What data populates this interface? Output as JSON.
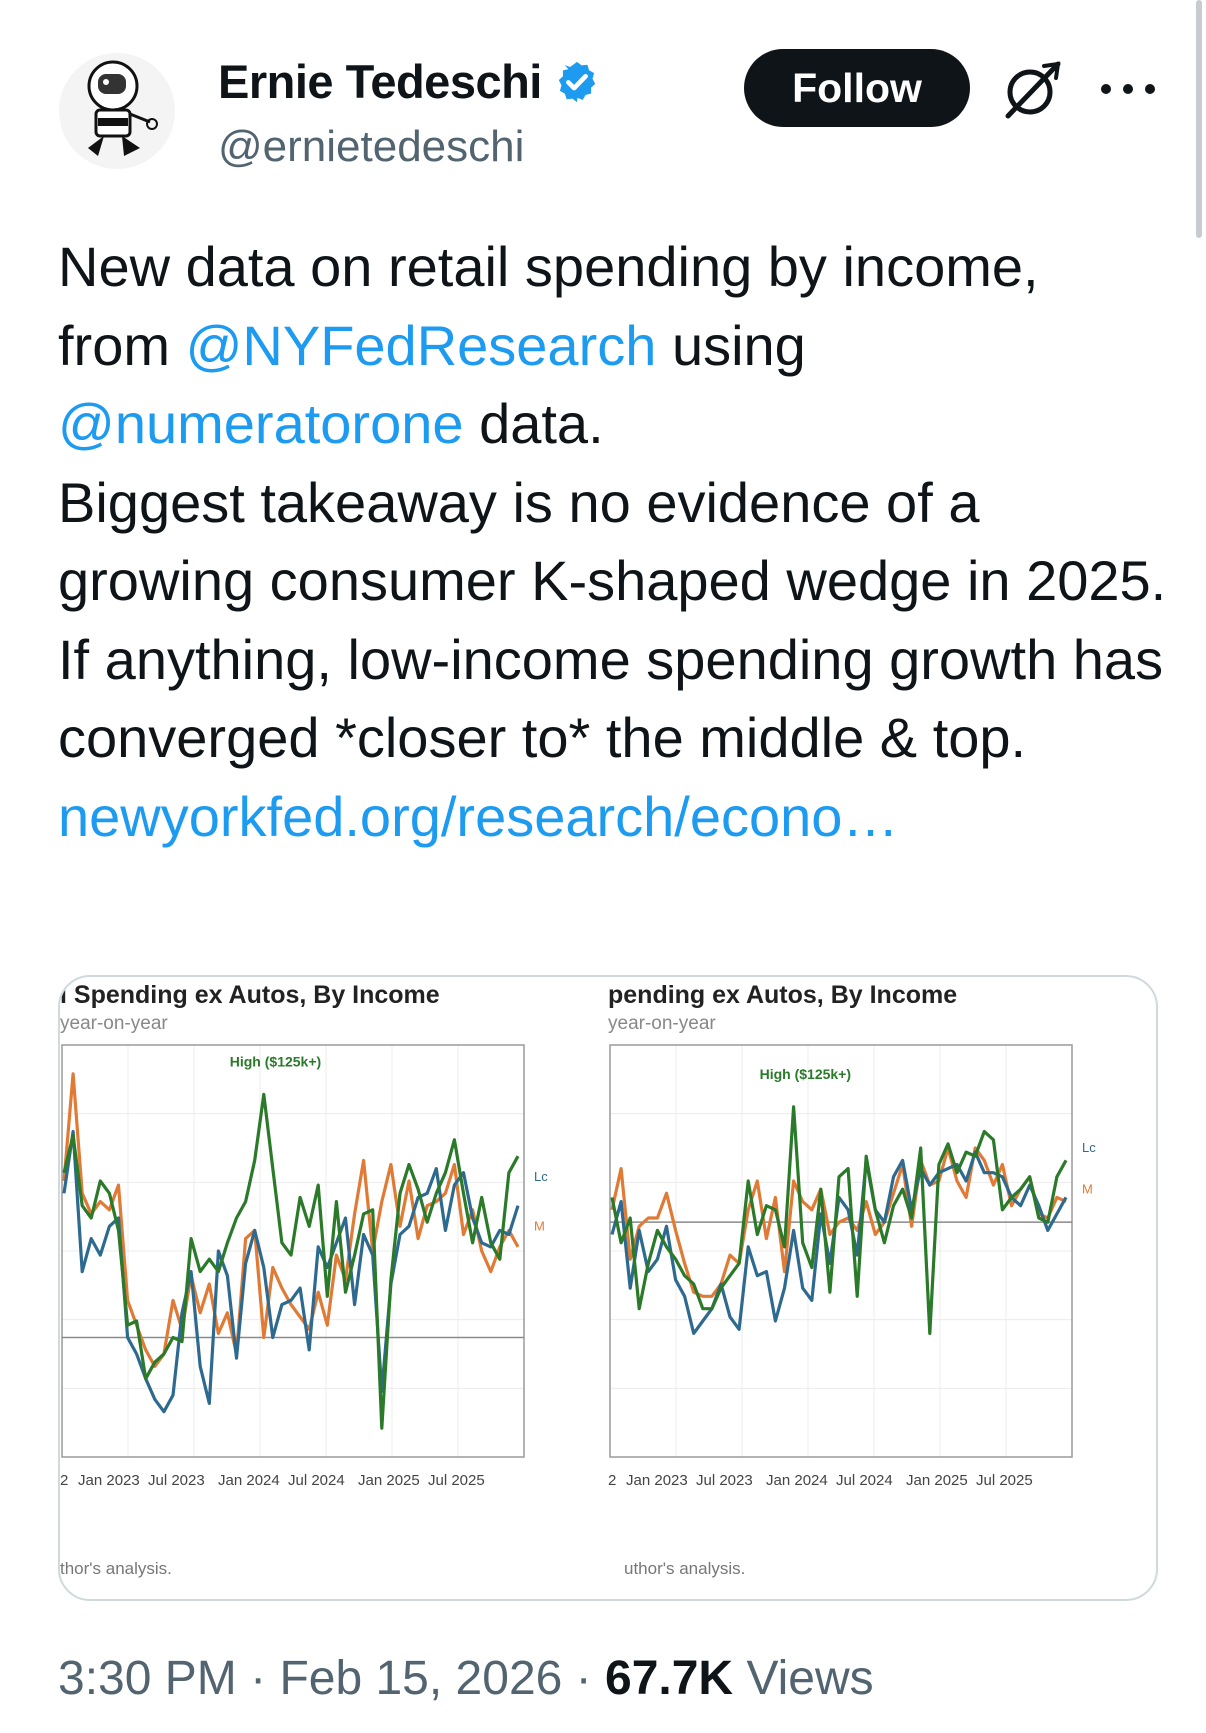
{
  "author": {
    "name": "Ernie Tedeschi",
    "handle": "@ernietedeschi",
    "verified": true,
    "verified_color": "#1d9bf0"
  },
  "actions": {
    "follow_label": "Follow",
    "grok_icon": "grok-icon",
    "more_icon": "more-icon"
  },
  "tweet": {
    "line1": "New data on retail spending by income,",
    "from_word": "from",
    "mention_nyfed": "@NYFedResearch",
    "using_word": "using",
    "mention_numerator": "@numeratorone",
    "data_word": "data.",
    "paragraph2": "Biggest takeaway is no evidence of a growing consumer K-shaped wedge in 2025. If anything, low-income spending growth has converged *closer to* the middle & top.",
    "link": "newyorkfed.org/research/econo…",
    "link_color": "#1d9bf0"
  },
  "media": {
    "left_title": "l Spending ex Autos, By Income",
    "left_subtitle": "year-on-year",
    "left_source": "thor's analysis.",
    "right_title": "pending ex Autos, By Income",
    "right_subtitle": "year-on-year",
    "right_source": "uthor's analysis."
  },
  "chart_data": [
    {
      "type": "line",
      "title": "l Spending ex Autos, By Income",
      "subtitle": "year-on-year",
      "x_tick_labels": [
        "2",
        "Jan 2023",
        "Jul 2023",
        "Jan 2024",
        "Jul 2024",
        "Jan 2025",
        "Jul 2025"
      ],
      "grid": true,
      "has_reference_line": true,
      "annotations": [
        "High ($125k+)",
        "Lc",
        "M"
      ],
      "x": [
        0,
        1,
        2,
        3,
        4,
        5,
        6,
        7,
        8,
        9,
        10,
        11,
        12,
        13,
        14,
        15,
        16,
        17,
        18,
        19,
        20,
        21,
        22,
        23,
        24,
        25,
        26,
        27,
        28,
        29,
        30,
        31,
        32,
        33,
        34,
        35,
        36,
        37,
        38,
        39,
        40,
        41,
        42,
        43,
        44,
        45,
        46,
        47,
        48,
        49,
        50
      ],
      "series": [
        {
          "name": "High ($125k+)",
          "color": "#2a7a2a",
          "values": [
            0.69,
            0.78,
            0.61,
            0.58,
            0.67,
            0.64,
            0.55,
            0.32,
            0.33,
            0.19,
            0.23,
            0.25,
            0.29,
            0.28,
            0.53,
            0.45,
            0.48,
            0.45,
            0.52,
            0.58,
            0.62,
            0.72,
            0.88,
            0.7,
            0.52,
            0.49,
            0.63,
            0.56,
            0.66,
            0.39,
            0.62,
            0.4,
            0.49,
            0.59,
            0.6,
            0.07,
            0.43,
            0.64,
            0.71,
            0.65,
            0.57,
            0.64,
            0.69,
            0.77,
            0.64,
            0.52,
            0.63,
            0.52,
            0.48,
            0.69,
            0.73
          ]
        },
        {
          "name": "",
          "color": "#e07a35",
          "values": [
            0.67,
            0.93,
            0.64,
            0.59,
            0.62,
            0.6,
            0.66,
            0.38,
            0.32,
            0.26,
            0.22,
            0.25,
            0.38,
            0.31,
            0.44,
            0.35,
            0.42,
            0.3,
            0.35,
            0.25,
            0.53,
            0.55,
            0.29,
            0.46,
            0.41,
            0.37,
            0.34,
            0.31,
            0.4,
            0.32,
            0.49,
            0.43,
            0.59,
            0.72,
            0.5,
            0.62,
            0.71,
            0.56,
            0.67,
            0.53,
            0.61,
            0.62,
            0.64,
            0.71,
            0.54,
            0.6,
            0.5,
            0.45,
            0.51,
            0.55,
            0.51
          ]
        },
        {
          "name": "",
          "color": "#2e6a8f",
          "values": [
            0.64,
            0.79,
            0.45,
            0.53,
            0.49,
            0.56,
            0.58,
            0.29,
            0.25,
            0.19,
            0.14,
            0.11,
            0.15,
            0.35,
            0.45,
            0.22,
            0.13,
            0.5,
            0.44,
            0.24,
            0.47,
            0.55,
            0.46,
            0.29,
            0.37,
            0.38,
            0.41,
            0.26,
            0.51,
            0.46,
            0.52,
            0.58,
            0.37,
            0.54,
            0.49,
            0.16,
            0.42,
            0.54,
            0.56,
            0.63,
            0.64,
            0.7,
            0.55,
            0.66,
            0.69,
            0.58,
            0.52,
            0.51,
            0.55,
            0.54,
            0.61
          ]
        }
      ]
    },
    {
      "type": "line",
      "title": "pending ex Autos, By Income",
      "subtitle": "year-on-year",
      "x_tick_labels": [
        "2",
        "Jan 2023",
        "Jul 2023",
        "Jan 2024",
        "Jul 2024",
        "Jan 2025",
        "Jul 2025"
      ],
      "grid": true,
      "has_reference_line": true,
      "annotations": [
        "High ($125k+)",
        "Lc",
        "M"
      ],
      "x": [
        0,
        1,
        2,
        3,
        4,
        5,
        6,
        7,
        8,
        9,
        10,
        11,
        12,
        13,
        14,
        15,
        16,
        17,
        18,
        19,
        20,
        21,
        22,
        23,
        24,
        25,
        26,
        27,
        28,
        29,
        30,
        31,
        32,
        33,
        34,
        35,
        36,
        37,
        38,
        39,
        40,
        41,
        42,
        43,
        44,
        45,
        46,
        47,
        48,
        49,
        50
      ],
      "series": [
        {
          "name": "High ($125k+)",
          "color": "#2a7a2a",
          "values": [
            0.63,
            0.52,
            0.58,
            0.36,
            0.47,
            0.55,
            0.51,
            0.48,
            0.44,
            0.42,
            0.36,
            0.36,
            0.41,
            0.44,
            0.47,
            0.67,
            0.54,
            0.61,
            0.6,
            0.51,
            0.85,
            0.52,
            0.46,
            0.65,
            0.4,
            0.68,
            0.7,
            0.39,
            0.73,
            0.6,
            0.52,
            0.61,
            0.65,
            0.58,
            0.75,
            0.3,
            0.71,
            0.76,
            0.69,
            0.74,
            0.73,
            0.79,
            0.77,
            0.6,
            0.63,
            0.65,
            0.68,
            0.58,
            0.57,
            0.68,
            0.72
          ]
        },
        {
          "name": "",
          "color": "#e07a35",
          "values": [
            0.6,
            0.7,
            0.48,
            0.56,
            0.58,
            0.58,
            0.64,
            0.55,
            0.47,
            0.4,
            0.39,
            0.39,
            0.42,
            0.49,
            0.47,
            0.6,
            0.67,
            0.53,
            0.63,
            0.45,
            0.67,
            0.62,
            0.6,
            0.65,
            0.54,
            0.57,
            0.58,
            0.55,
            0.62,
            0.54,
            0.57,
            0.64,
            0.71,
            0.56,
            0.72,
            0.66,
            0.67,
            0.75,
            0.67,
            0.63,
            0.75,
            0.72,
            0.66,
            0.71,
            0.61,
            0.65,
            0.68,
            0.59,
            0.58,
            0.63,
            0.62
          ]
        },
        {
          "name": "",
          "color": "#2e6a8f",
          "values": [
            0.54,
            0.62,
            0.41,
            0.55,
            0.45,
            0.48,
            0.56,
            0.43,
            0.39,
            0.3,
            0.33,
            0.36,
            0.42,
            0.34,
            0.31,
            0.51,
            0.44,
            0.45,
            0.33,
            0.41,
            0.55,
            0.41,
            0.38,
            0.59,
            0.47,
            0.63,
            0.6,
            0.49,
            0.72,
            0.6,
            0.57,
            0.68,
            0.72,
            0.6,
            0.7,
            0.66,
            0.69,
            0.7,
            0.71,
            0.67,
            0.74,
            0.69,
            0.69,
            0.68,
            0.63,
            0.61,
            0.66,
            0.61,
            0.55,
            0.59,
            0.63
          ]
        }
      ]
    }
  ],
  "footer": {
    "time": "3:30 PM",
    "separator": "·",
    "date": "Feb 15, 2026",
    "views_count": "67.7K",
    "views_label": "Views"
  }
}
